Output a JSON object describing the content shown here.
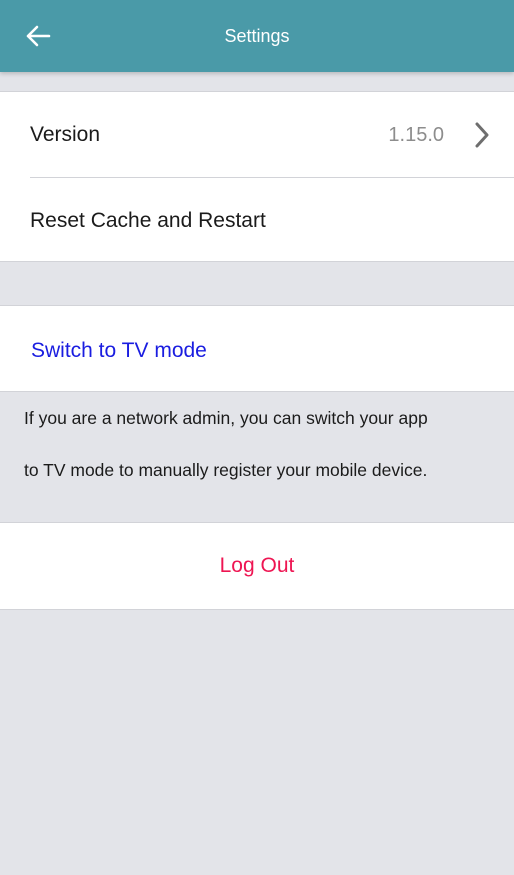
{
  "header": {
    "title": "Settings",
    "back_icon": "arrow-left-icon",
    "background_color": "#4a9aa8"
  },
  "settings": {
    "version_label": "Version",
    "version_value": "1.15.0",
    "reset_label": "Reset Cache and Restart"
  },
  "tv_mode": {
    "link_label": "Switch to TV mode",
    "link_color": "#1a1de0",
    "info_line_1": "If you are a network admin, you can switch your app",
    "info_line_2": "to TV mode to manually register your mobile device."
  },
  "logout": {
    "label": "Log Out",
    "color": "#ee1552"
  }
}
